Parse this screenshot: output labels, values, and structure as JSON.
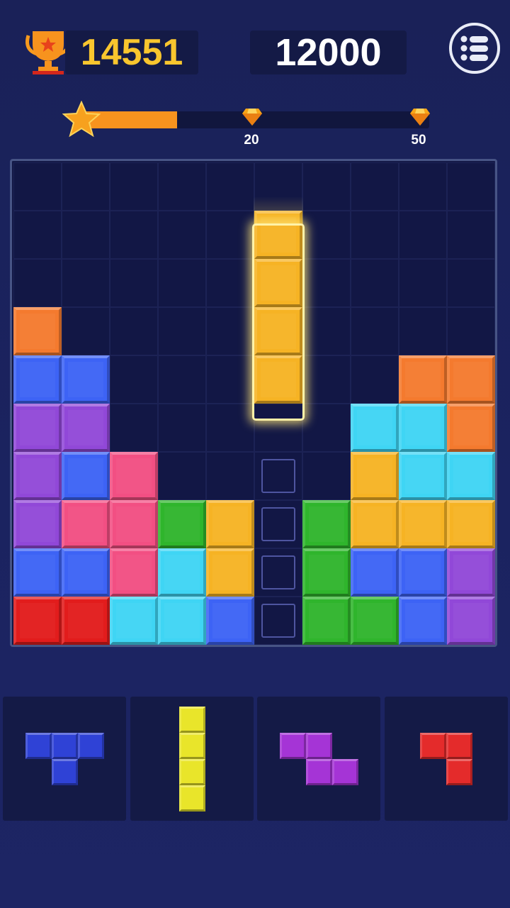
{
  "hud": {
    "best_score": "14551",
    "current_score": "12000",
    "menu_icon": "list-menu-icon",
    "trophy_icon": "trophy-icon"
  },
  "progress": {
    "fill_fraction": 0.27,
    "milestones": [
      {
        "label": "20",
        "icon": "diamond-icon"
      },
      {
        "label": "50",
        "icon": "diamond-icon"
      }
    ]
  },
  "colors": {
    "O": "#f47a2e",
    "B": "#3d63f5",
    "P": "#9148d8",
    "K": "#f24f83",
    "G": "#2fb52c",
    "Y": "#f6b324",
    "C": "#3fd5f4",
    "R": "#e21c1c",
    "blue": "#2f42d6",
    "yellow": "#e9e52a",
    "purple": "#a534d6",
    "red": "#e42b2b",
    "accent_gold": "#f9c62e",
    "progress_orange": "#f7931e"
  },
  "board": {
    "rows": [
      "..........",
      "..........",
      "..........",
      "O.........",
      "BB......OO",
      "PP.....CCO",
      "PBK....YCC",
      "PKKGY.GYYY",
      "BBKCY.GBBP",
      "RRCCB.GGBP"
    ],
    "ghost_cells": [
      [
        6,
        5
      ],
      [
        7,
        5
      ],
      [
        8,
        5
      ],
      [
        9,
        5
      ]
    ],
    "dragged_piece": {
      "color": "Y",
      "cells": [
        [
          1,
          5
        ],
        [
          2,
          5
        ],
        [
          3,
          5
        ],
        [
          4,
          5
        ]
      ]
    }
  },
  "tray": [
    {
      "color": "blue",
      "cells": [
        [
          0,
          0
        ],
        [
          0,
          1
        ],
        [
          0,
          2
        ],
        [
          1,
          1
        ]
      ]
    },
    {
      "color": "yellow",
      "cells": [
        [
          0,
          0
        ],
        [
          1,
          0
        ],
        [
          2,
          0
        ],
        [
          3,
          0
        ]
      ]
    },
    {
      "color": "purple",
      "cells": [
        [
          0,
          0
        ],
        [
          0,
          1
        ],
        [
          1,
          1
        ],
        [
          1,
          2
        ]
      ]
    },
    {
      "color": "red",
      "cells": [
        [
          0,
          0
        ],
        [
          0,
          1
        ],
        [
          1,
          1
        ]
      ]
    }
  ]
}
